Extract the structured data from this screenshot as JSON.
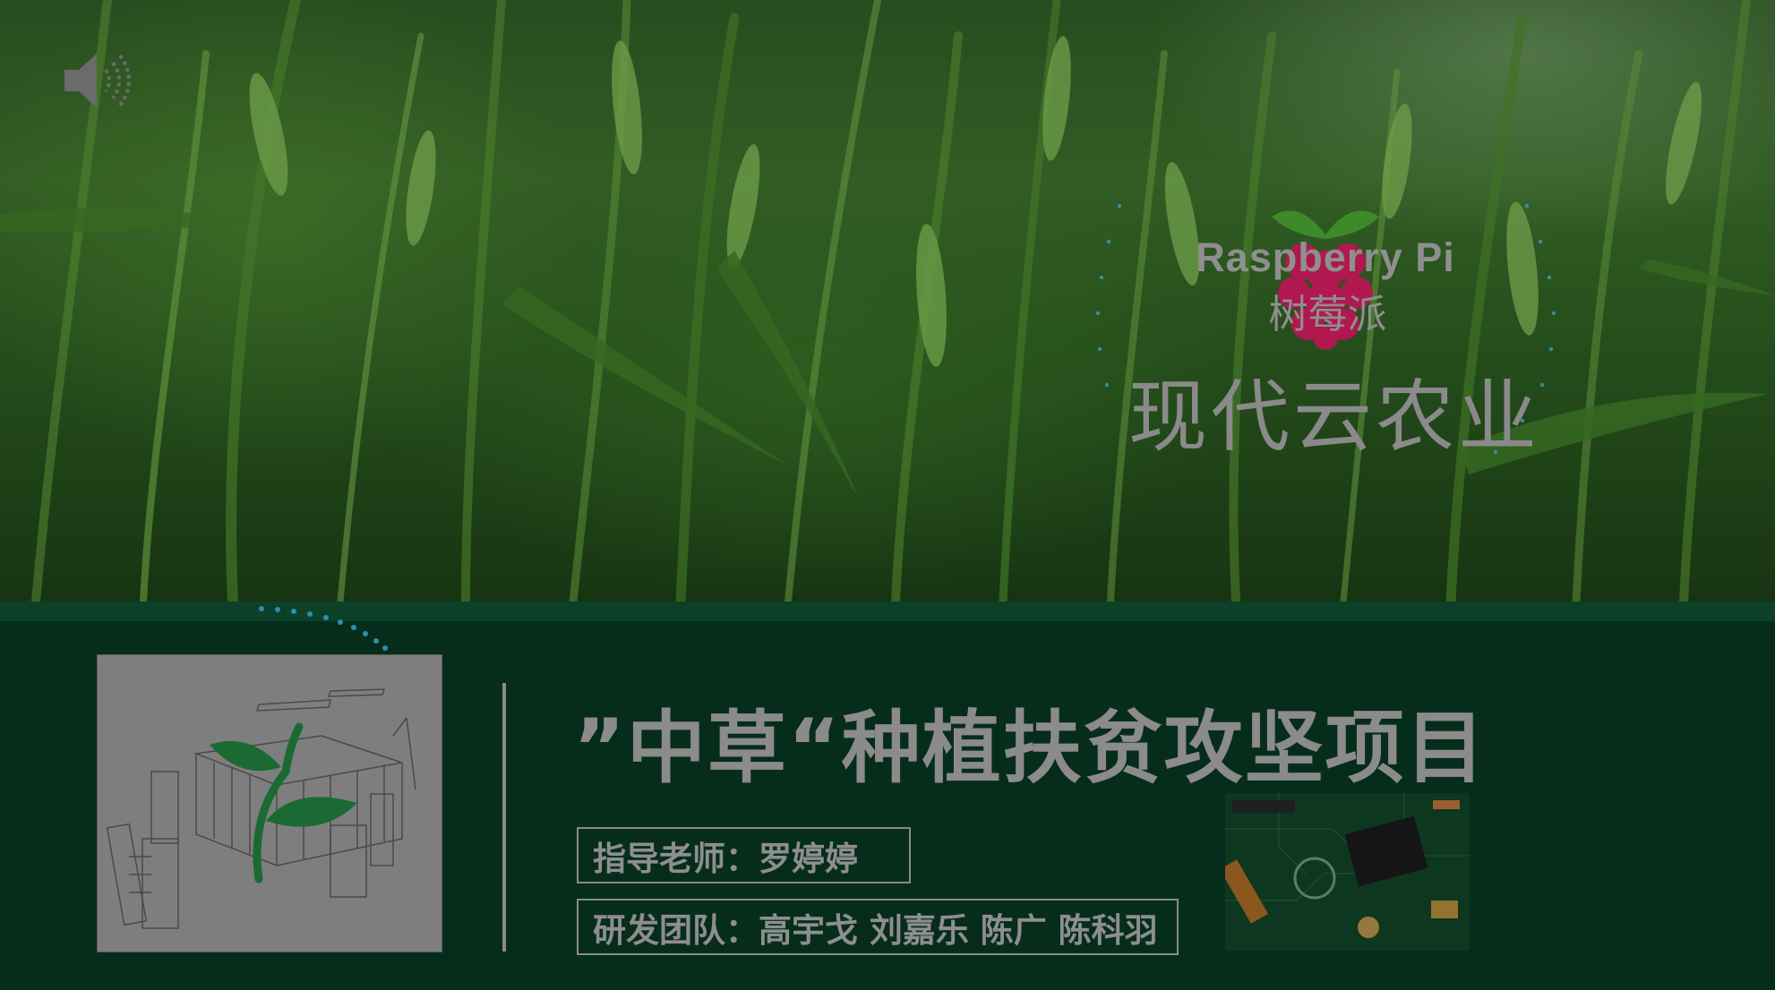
{
  "slide": {
    "logo": {
      "name": "raspberry-pi-logo",
      "brand_text": "Raspberry Pi",
      "brand_subtext": "树莓派"
    },
    "cloud_title": "现代云农业",
    "project_title": "”中草“种植扶贫攻坚项目",
    "advisor": "指导老师：罗婷婷",
    "team": "研发团队：高宇戈  刘嘉乐  陈广  陈科羽"
  },
  "icons": {
    "audio": "speaker-icon"
  },
  "colors": {
    "banner": "#062d1c",
    "banner_strip": "#0c4028",
    "text": "#8b8b8b",
    "dots": "#2a8fb0",
    "raspberry": "#c2185b",
    "leaf": "#1b6a34"
  }
}
